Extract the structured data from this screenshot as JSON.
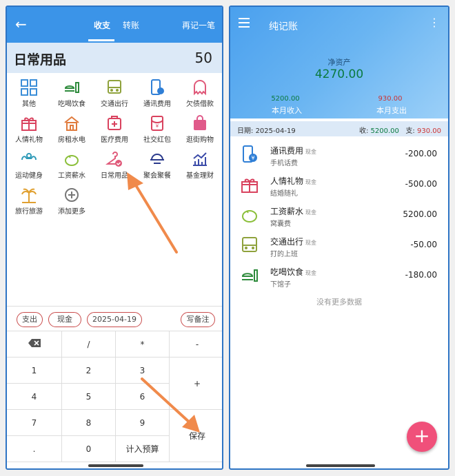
{
  "left": {
    "topbar": {
      "back_icon": "arrow-left-icon",
      "tab_expense": "收支",
      "tab_transfer": "转账",
      "record_again": "再记一笔"
    },
    "category_header": {
      "name": "日常用品",
      "amount": "50"
    },
    "categories": [
      {
        "label": "其他",
        "icon": "grid-icon"
      },
      {
        "label": "吃喝饮食",
        "icon": "food-icon"
      },
      {
        "label": "交通出行",
        "icon": "bus-icon"
      },
      {
        "label": "通讯费用",
        "icon": "phone-icon"
      },
      {
        "label": "欠债借款",
        "icon": "ghost-icon"
      },
      {
        "label": "人情礼物",
        "icon": "gift-icon"
      },
      {
        "label": "房租水电",
        "icon": "house-icon"
      },
      {
        "label": "医疗费用",
        "icon": "medical-icon"
      },
      {
        "label": "社交红包",
        "icon": "red-packet-icon"
      },
      {
        "label": "逛街购物",
        "icon": "shopping-bag-icon"
      },
      {
        "label": "运动健身",
        "icon": "fitness-icon"
      },
      {
        "label": "工资薪水",
        "icon": "piggy-bank-icon"
      },
      {
        "label": "日常用品",
        "icon": "hanger-icon"
      },
      {
        "label": "聚会聚餐",
        "icon": "dining-icon"
      },
      {
        "label": "基金理财",
        "icon": "chart-icon"
      },
      {
        "label": "旅行旅游",
        "icon": "palm-tree-icon"
      },
      {
        "label": "添加更多",
        "icon": "add-icon"
      }
    ],
    "chips": {
      "type": "支出",
      "account": "现金",
      "date": "2025-04-19",
      "note": "写备注"
    },
    "keys": {
      "backspace_icon": "backspace-icon",
      "divide": "/",
      "multiply": "*",
      "minus": "-",
      "plus": "+",
      "k1": "1",
      "k2": "2",
      "k3": "3",
      "k4": "4",
      "k5": "5",
      "k6": "6",
      "k7": "7",
      "k8": "8",
      "k9": "9",
      "dot": ".",
      "k0": "0",
      "budget": "计入预算",
      "save": "保存"
    }
  },
  "right": {
    "header": {
      "menu_icon": "menu-icon",
      "title": "纯记账",
      "more_icon": "more-vertical-icon",
      "net_label": "净资产",
      "net_value": "4270.00",
      "income_value": "5200.00",
      "income_label": "本月收入",
      "expense_value": "930.00",
      "expense_label": "本月支出"
    },
    "day": {
      "date_label": "日期:",
      "date": "2025-04-19",
      "income_label": "收:",
      "income": "5200.00",
      "expense_label": "支:",
      "expense": "930.00"
    },
    "records": [
      {
        "name": "通讯费用",
        "tag": "现金",
        "memo": "手机话费",
        "amount": "-200.00",
        "icon": "phone-icon"
      },
      {
        "name": "人情礼物",
        "tag": "现金",
        "memo": "结婚随礼",
        "amount": "-500.00",
        "icon": "gift-icon"
      },
      {
        "name": "工资薪水",
        "tag": "现金",
        "memo": "窝囊费",
        "amount": "5200.00",
        "icon": "piggy-bank-icon"
      },
      {
        "name": "交通出行",
        "tag": "现金",
        "memo": "打的上班",
        "amount": "-50.00",
        "icon": "bus-icon"
      },
      {
        "name": "吃喝饮食",
        "tag": "现金",
        "memo": "下馆子",
        "amount": "-180.00",
        "icon": "food-icon"
      }
    ],
    "no_more": "没有更多数据",
    "fab": "+"
  },
  "colors": {
    "primary": "#3b94e8",
    "income_green": "#0a7a40",
    "expense_red": "#cc3333",
    "fab_pink": "#f0507a",
    "arrow_orange": "#f08a4b"
  }
}
